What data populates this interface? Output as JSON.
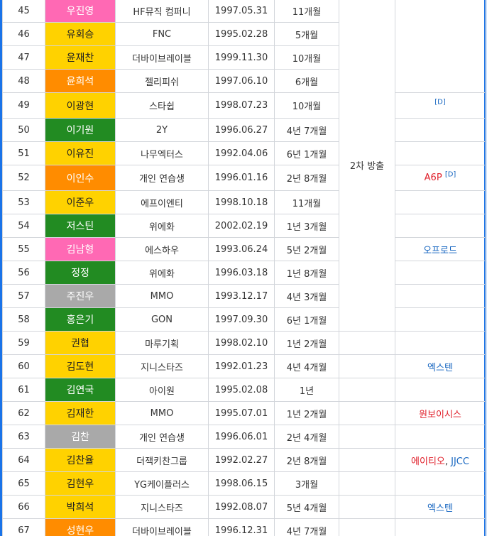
{
  "status_group": "2차 방출",
  "rows": [
    {
      "no": "45",
      "name": "우진영",
      "color": "pink",
      "company": "HF뮤직 컴퍼니",
      "birth": "1997.05.31",
      "duration": "11개월"
    },
    {
      "no": "46",
      "name": "유회승",
      "color": "yellow",
      "company": "FNC",
      "birth": "1995.02.28",
      "duration": "5개월"
    },
    {
      "no": "47",
      "name": "윤재찬",
      "color": "yellow",
      "company": "더바이브레이블",
      "birth": "1999.11.30",
      "duration": "10개월"
    },
    {
      "no": "48",
      "name": "윤희석",
      "color": "orange",
      "company": "젤리피쉬",
      "birth": "1997.06.10",
      "duration": "6개월"
    },
    {
      "no": "49",
      "name": "이광현",
      "color": "yellow",
      "company": "스타쉽",
      "birth": "1998.07.23",
      "duration": "10개월",
      "debut": "",
      "note": "[D]"
    },
    {
      "no": "50",
      "name": "이기원",
      "color": "green",
      "company": "2Y",
      "birth": "1996.06.27",
      "duration": "4년 7개월"
    },
    {
      "no": "51",
      "name": "이유진",
      "color": "yellow",
      "company": "나무엑터스",
      "birth": "1992.04.06",
      "duration": "6년 1개월"
    },
    {
      "no": "52",
      "name": "이인수",
      "color": "orange",
      "company": "개인 연습생",
      "birth": "1996.01.16",
      "duration": "2년 8개월",
      "debut": "A6P",
      "debut_color": "red",
      "note": "[D]"
    },
    {
      "no": "53",
      "name": "이준우",
      "color": "yellow",
      "company": "에프이엔티",
      "birth": "1998.10.18",
      "duration": "11개월"
    },
    {
      "no": "54",
      "name": "저스틴",
      "color": "green",
      "company": "위에화",
      "birth": "2002.02.19",
      "duration": "1년 3개월"
    },
    {
      "no": "55",
      "name": "김남형",
      "color": "pink",
      "company": "에스하우",
      "birth": "1993.06.24",
      "duration": "5년 2개월",
      "debut": "오프로드",
      "debut_color": "blue"
    },
    {
      "no": "56",
      "name": "정정",
      "color": "green",
      "company": "위에화",
      "birth": "1996.03.18",
      "duration": "1년 8개월"
    },
    {
      "no": "57",
      "name": "주진우",
      "color": "gray",
      "company": "MMO",
      "birth": "1993.12.17",
      "duration": "4년 3개월"
    },
    {
      "no": "58",
      "name": "홍은기",
      "color": "green",
      "company": "GON",
      "birth": "1997.09.30",
      "duration": "6년 1개월"
    },
    {
      "no": "59",
      "name": "권협",
      "color": "yellow",
      "company": "마루기획",
      "birth": "1998.02.10",
      "duration": "1년 2개월"
    },
    {
      "no": "60",
      "name": "김도현",
      "color": "yellow",
      "company": "지니스타즈",
      "birth": "1992.01.23",
      "duration": "4년 4개월",
      "debut": "엑스텐",
      "debut_color": "blue"
    },
    {
      "no": "61",
      "name": "김연국",
      "color": "green",
      "company": "아이원",
      "birth": "1995.02.08",
      "duration": "1년"
    },
    {
      "no": "62",
      "name": "김재한",
      "color": "yellow",
      "company": "MMO",
      "birth": "1995.07.01",
      "duration": "1년 2개월",
      "debut": "원보이시스",
      "debut_color": "red"
    },
    {
      "no": "63",
      "name": "김찬",
      "color": "gray",
      "company": "개인 연습생",
      "birth": "1996.06.01",
      "duration": "2년 4개월"
    },
    {
      "no": "64",
      "name": "김찬율",
      "color": "yellow",
      "company": "더잭키찬그룹",
      "birth": "1992.02.27",
      "duration": "2년 8개월",
      "debut": "에이티오",
      "debut_color": "red",
      "debut2": "JJCC",
      "debut2_color": "blue"
    },
    {
      "no": "65",
      "name": "김현우",
      "color": "yellow",
      "company": "YG케이플러스",
      "birth": "1998.06.15",
      "duration": "3개월"
    },
    {
      "no": "66",
      "name": "박희석",
      "color": "yellow",
      "company": "지니스타즈",
      "birth": "1992.08.07",
      "duration": "5년 4개월",
      "debut": "엑스텐",
      "debut_color": "blue"
    },
    {
      "no": "67",
      "name": "성현우",
      "color": "orange",
      "company": "더바이브레이블",
      "birth": "1996.12.31",
      "duration": "4년 7개월"
    }
  ],
  "colors": {
    "pink": "#ff69b4",
    "yellow": "#ffd200",
    "orange": "#ff8c00",
    "green": "#228b22",
    "gray": "#a9a9a9",
    "link_blue": "#1565c0",
    "link_red": "#e0202b",
    "border": "#d3d6db",
    "frame": "#1a73e8"
  }
}
